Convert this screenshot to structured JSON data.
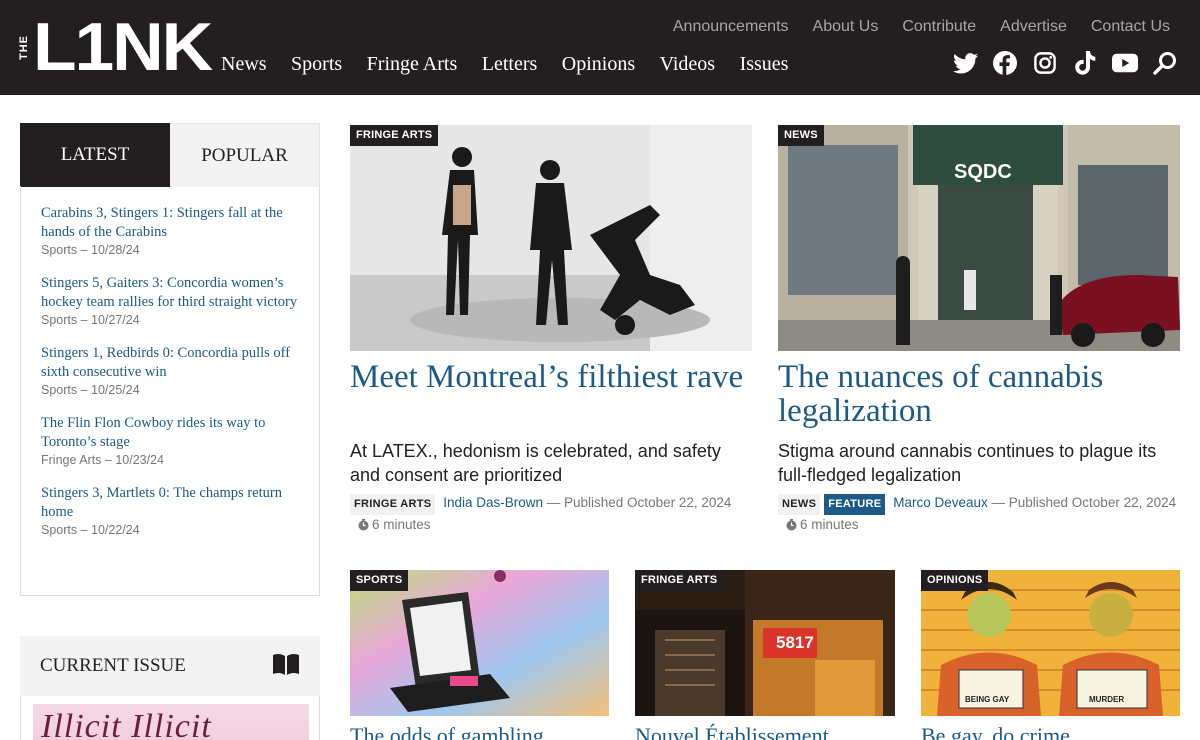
{
  "logo": {
    "the": "THE",
    "word": "L1NK"
  },
  "topnav": [
    "Announcements",
    "About Us",
    "Contribute",
    "Advertise",
    "Contact Us"
  ],
  "mainnav": [
    "News",
    "Sports",
    "Fringe Arts",
    "Letters",
    "Opinions",
    "Videos",
    "Issues"
  ],
  "social": [
    "twitter-icon",
    "facebook-icon",
    "instagram-icon",
    "tiktok-icon",
    "youtube-icon",
    "search-icon"
  ],
  "sidebar": {
    "tabs": {
      "latest": "LATEST",
      "popular": "POPULAR"
    },
    "latest": [
      {
        "title": "Carabins 3, Stingers 1: Stingers fall at the hands of the Carabins",
        "meta": "Sports – 10/28/24"
      },
      {
        "title": "Stingers 5, Gaiters 3: Concordia women’s hockey team rallies for third straight victory",
        "meta": "Sports – 10/27/24"
      },
      {
        "title": "Stingers 1, Redbirds 0: Concordia pulls off sixth consecutive win",
        "meta": "Sports – 10/25/24"
      },
      {
        "title": "The Flin Flon Cowboy rides its way to Toronto’s stage",
        "meta": "Fringe Arts – 10/23/24"
      },
      {
        "title": "Stingers 3, Martlets 0: The champs return home",
        "meta": "Sports – 10/22/24"
      }
    ],
    "current_issue": "CURRENT ISSUE",
    "issue_cover_text": "Illicit Illicit"
  },
  "features": [
    {
      "badge": "FRINGE ARTS",
      "title": "Meet Montreal’s filthiest rave",
      "dek": "At LATEX., hedonism is celebrated, and safety and consent are prioritized",
      "tags": [
        "FRINGE ARTS"
      ],
      "author": "India Das-Brown",
      "published": " — Published October 22, 2024",
      "read_time": "6 minutes"
    },
    {
      "badge": "NEWS",
      "title": "The nuances of cannabis legalization",
      "dek": "Stigma around cannabis continues to plague its full-fledged legalization",
      "tags": [
        "NEWS",
        "FEATURE"
      ],
      "author": "Marco Deveaux",
      "published": " — Published October 22, 2024",
      "read_time": "6 minutes",
      "sign_text": "SQDC"
    }
  ],
  "cards": [
    {
      "badge": "SPORTS",
      "title": "The odds of gambling"
    },
    {
      "badge": "FRINGE ARTS",
      "title": "Nouvel Établissement",
      "sign_text": "5817"
    },
    {
      "badge": "OPINIONS",
      "title": "Be gay, do crime",
      "sign_left": "BEING GAY",
      "sign_right": "MURDER"
    }
  ],
  "colors": {
    "header_bg": "#231f20",
    "link": "#1d5a87",
    "meta": "#777777"
  }
}
